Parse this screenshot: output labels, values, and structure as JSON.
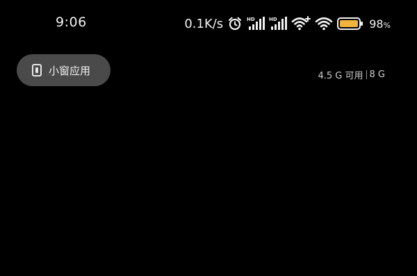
{
  "status_bar": {
    "time": "9:06",
    "net_speed": "0.1K/s",
    "icons": [
      "alarm-icon",
      "signal-hd-icon",
      "signal-hd-icon",
      "wifi-plus-icon",
      "wifi-icon",
      "battery-icon"
    ],
    "battery_percent": "98",
    "battery_sign": "%",
    "battery_color": "#f0b43c"
  },
  "recents": {
    "small_window_label": "小窗应用",
    "memory_available": "4.5 G 可用",
    "memory_total": "8 G"
  }
}
